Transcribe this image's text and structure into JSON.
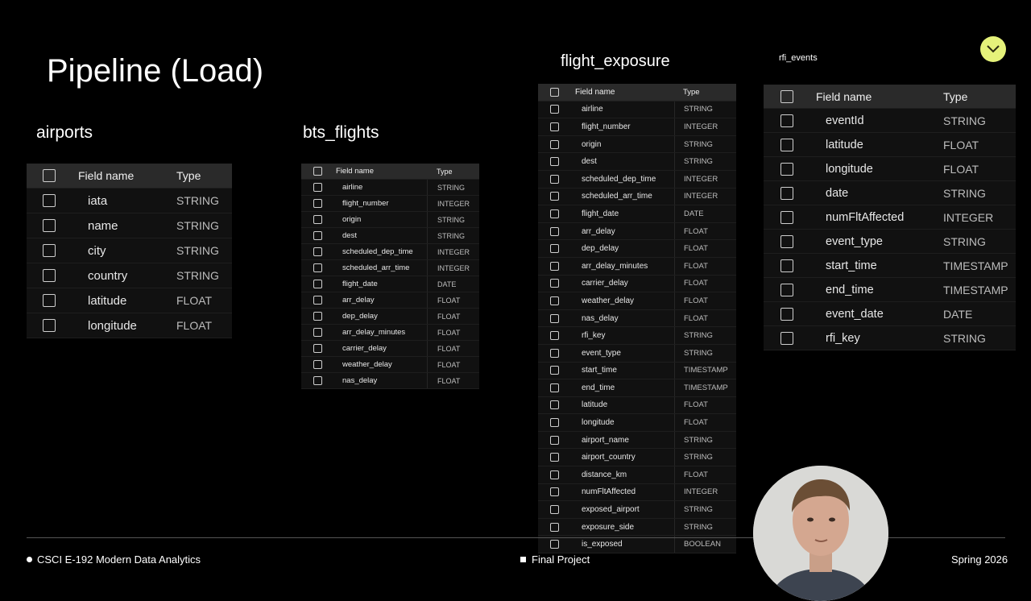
{
  "slide": {
    "title": "Pipeline (Load)"
  },
  "header_labels": {
    "field_name": "Field name",
    "type": "Type"
  },
  "tables": {
    "airports": {
      "title": "airports",
      "fields": [
        {
          "name": "iata",
          "type": "STRING"
        },
        {
          "name": "name",
          "type": "STRING"
        },
        {
          "name": "city",
          "type": "STRING"
        },
        {
          "name": "country",
          "type": "STRING"
        },
        {
          "name": "latitude",
          "type": "FLOAT"
        },
        {
          "name": "longitude",
          "type": "FLOAT"
        }
      ]
    },
    "bts_flights": {
      "title": "bts_flights",
      "fields": [
        {
          "name": "airline",
          "type": "STRING"
        },
        {
          "name": "flight_number",
          "type": "INTEGER"
        },
        {
          "name": "origin",
          "type": "STRING"
        },
        {
          "name": "dest",
          "type": "STRING"
        },
        {
          "name": "scheduled_dep_time",
          "type": "INTEGER"
        },
        {
          "name": "scheduled_arr_time",
          "type": "INTEGER"
        },
        {
          "name": "flight_date",
          "type": "DATE"
        },
        {
          "name": "arr_delay",
          "type": "FLOAT"
        },
        {
          "name": "dep_delay",
          "type": "FLOAT"
        },
        {
          "name": "arr_delay_minutes",
          "type": "FLOAT"
        },
        {
          "name": "carrier_delay",
          "type": "FLOAT"
        },
        {
          "name": "weather_delay",
          "type": "FLOAT"
        },
        {
          "name": "nas_delay",
          "type": "FLOAT"
        }
      ]
    },
    "flight_exposure": {
      "title": "flight_exposure",
      "fields": [
        {
          "name": "airline",
          "type": "STRING"
        },
        {
          "name": "flight_number",
          "type": "INTEGER"
        },
        {
          "name": "origin",
          "type": "STRING"
        },
        {
          "name": "dest",
          "type": "STRING"
        },
        {
          "name": "scheduled_dep_time",
          "type": "INTEGER"
        },
        {
          "name": "scheduled_arr_time",
          "type": "INTEGER"
        },
        {
          "name": "flight_date",
          "type": "DATE"
        },
        {
          "name": "arr_delay",
          "type": "FLOAT"
        },
        {
          "name": "dep_delay",
          "type": "FLOAT"
        },
        {
          "name": "arr_delay_minutes",
          "type": "FLOAT"
        },
        {
          "name": "carrier_delay",
          "type": "FLOAT"
        },
        {
          "name": "weather_delay",
          "type": "FLOAT"
        },
        {
          "name": "nas_delay",
          "type": "FLOAT"
        },
        {
          "name": "rfi_key",
          "type": "STRING"
        },
        {
          "name": "event_type",
          "type": "STRING"
        },
        {
          "name": "start_time",
          "type": "TIMESTAMP"
        },
        {
          "name": "end_time",
          "type": "TIMESTAMP"
        },
        {
          "name": "latitude",
          "type": "FLOAT"
        },
        {
          "name": "longitude",
          "type": "FLOAT"
        },
        {
          "name": "airport_name",
          "type": "STRING"
        },
        {
          "name": "airport_country",
          "type": "STRING"
        },
        {
          "name": "distance_km",
          "type": "FLOAT"
        },
        {
          "name": "numFltAffected",
          "type": "INTEGER"
        },
        {
          "name": "exposed_airport",
          "type": "STRING"
        },
        {
          "name": "exposure_side",
          "type": "STRING"
        },
        {
          "name": "is_exposed",
          "type": "BOOLEAN"
        }
      ]
    },
    "rfi_events": {
      "title": "rfi_events",
      "fields": [
        {
          "name": "eventId",
          "type": "STRING"
        },
        {
          "name": "latitude",
          "type": "FLOAT"
        },
        {
          "name": "longitude",
          "type": "FLOAT"
        },
        {
          "name": "date",
          "type": "STRING"
        },
        {
          "name": "numFltAffected",
          "type": "INTEGER"
        },
        {
          "name": "event_type",
          "type": "STRING"
        },
        {
          "name": "start_time",
          "type": "TIMESTAMP"
        },
        {
          "name": "end_time",
          "type": "TIMESTAMP"
        },
        {
          "name": "event_date",
          "type": "DATE"
        },
        {
          "name": "rfi_key",
          "type": "STRING"
        }
      ]
    }
  },
  "footer": {
    "course": "CSCI E-192 Modern Data Analytics",
    "section": "Final Project",
    "term": "Spring 2026"
  },
  "icons": {
    "corner_button": "chevron-down-icon"
  },
  "colors": {
    "accent": "#e5f27a",
    "background": "#000000"
  }
}
